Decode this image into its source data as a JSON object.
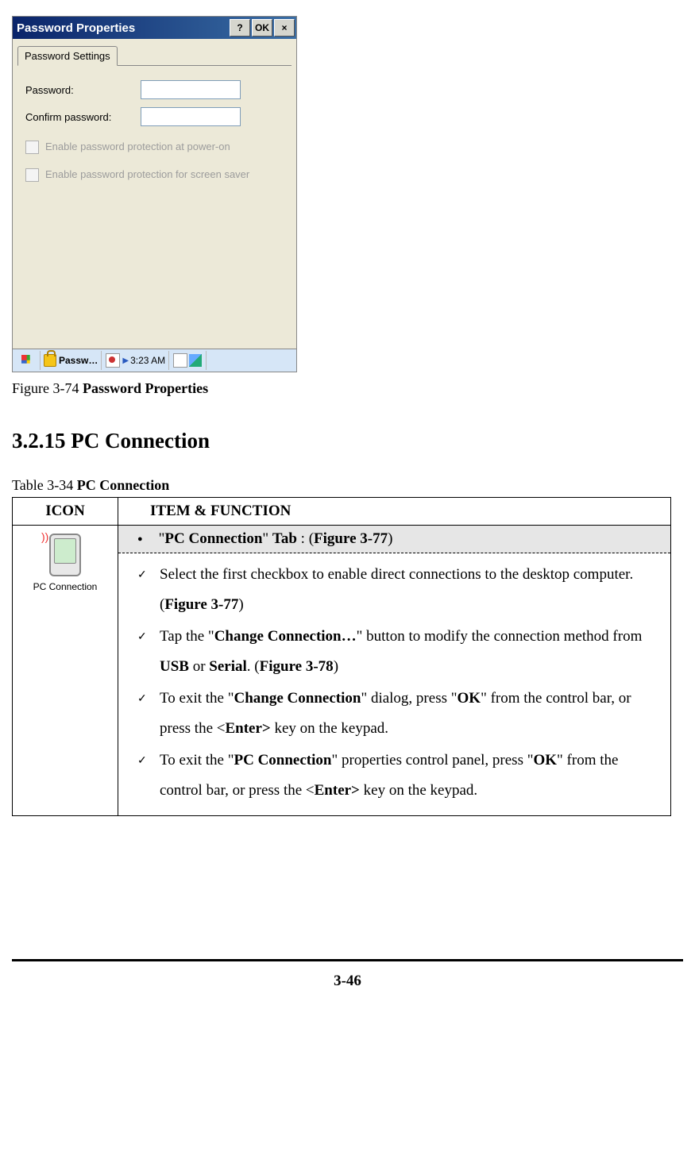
{
  "dialog": {
    "title": "Password Properties",
    "help_btn": "?",
    "ok_btn": "OK",
    "close_btn": "×",
    "tab": "Password Settings",
    "password_label": "Password:",
    "confirm_label": "Confirm password:",
    "check1": "Enable password protection at power-on",
    "check2": "Enable password protection for screen saver",
    "taskbar_app": "Passw…",
    "taskbar_time": "3:23 AM"
  },
  "figure_caption_prefix": "Figure 3-74 ",
  "figure_caption_bold": "Password Properties",
  "section_heading": "3.2.15 PC Connection",
  "table_caption_prefix": "Table 3-34 ",
  "table_caption_bold": "PC Connection",
  "table_headers": {
    "icon": "ICON",
    "func": "ITEM & FUNCTION"
  },
  "icon_label": "PC Connection",
  "tab_line": {
    "bullet": "●",
    "q1": "\"",
    "name": "PC Connection",
    "q2": "\" ",
    "tab_word": "Tab",
    "colon": " : (",
    "fig": "Figure 3-77",
    "close": ")"
  },
  "items": [
    {
      "frags": [
        {
          "t": "Select the first checkbox to enable direct connections to the desktop computer. ("
        },
        {
          "t": "Figure 3-77",
          "b": true
        },
        {
          "t": ")"
        }
      ]
    },
    {
      "frags": [
        {
          "t": "Tap the \""
        },
        {
          "t": "Change Connection…",
          "b": true
        },
        {
          "t": "\" button to modify the connection method from "
        },
        {
          "t": "USB",
          "b": true
        },
        {
          "t": " or "
        },
        {
          "t": "Serial",
          "b": true
        },
        {
          "t": ". ("
        },
        {
          "t": "Figure 3-78",
          "b": true
        },
        {
          "t": ")"
        }
      ]
    },
    {
      "frags": [
        {
          "t": "To exit the \""
        },
        {
          "t": "Change Connection",
          "b": true
        },
        {
          "t": "\" dialog, press \""
        },
        {
          "t": "OK",
          "b": true
        },
        {
          "t": "\" from the control bar, or press the <"
        },
        {
          "t": "Enter>",
          "b": true
        },
        {
          "t": " key on the keypad."
        }
      ]
    },
    {
      "frags": [
        {
          "t": "To exit the \""
        },
        {
          "t": "PC Connection",
          "b": true
        },
        {
          "t": "\" properties control panel, press \""
        },
        {
          "t": "OK",
          "b": true
        },
        {
          "t": "\" from the control bar, or press the <"
        },
        {
          "t": "Enter>",
          "b": true
        },
        {
          "t": " key on the keypad."
        }
      ]
    }
  ],
  "check_mark": "✓",
  "page_number": "3-46"
}
